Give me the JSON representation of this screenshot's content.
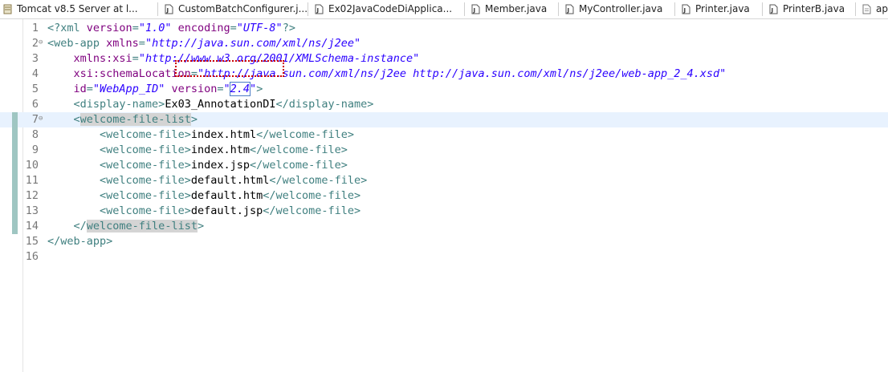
{
  "tabs": [
    {
      "label": "Tomcat v8.5 Server at l...",
      "icon": "server-icon"
    },
    {
      "label": "CustomBatchConfigurer.j...",
      "icon": "java-file-icon"
    },
    {
      "label": "Ex02JavaCodeDiApplica...",
      "icon": "java-file-icon"
    },
    {
      "label": "Member.java",
      "icon": "java-file-icon"
    },
    {
      "label": "MyController.java",
      "icon": "java-file-icon"
    },
    {
      "label": "Printer.java",
      "icon": "java-file-icon"
    },
    {
      "label": "PrinterB.java",
      "icon": "java-file-icon"
    },
    {
      "label": "ap",
      "icon": "file-icon"
    }
  ],
  "editor": {
    "lines": [
      {
        "n": "1",
        "fold": "",
        "t": [
          [
            "tag",
            "<?xml "
          ],
          [
            "attr",
            "version"
          ],
          [
            "tag",
            "="
          ],
          [
            "val",
            "\"1.0\""
          ],
          [
            "txt",
            " "
          ],
          [
            "attr",
            "encoding"
          ],
          [
            "tag",
            "="
          ],
          [
            "val",
            "\"UTF-8\""
          ],
          [
            "tag",
            "?>"
          ]
        ]
      },
      {
        "n": "2",
        "fold": "⊖",
        "t": [
          [
            "tag",
            "<web-app "
          ],
          [
            "attr",
            "xmlns"
          ],
          [
            "tag",
            "="
          ],
          [
            "val",
            "\"http://java.sun.com/xml/ns/j2ee\""
          ]
        ]
      },
      {
        "n": "3",
        "fold": "",
        "t": [
          [
            "txt",
            "    "
          ],
          [
            "attr",
            "xmlns:xsi"
          ],
          [
            "tag",
            "="
          ],
          [
            "val",
            "\"http://www.w3.org/2001/XMLSchema-instance\""
          ]
        ]
      },
      {
        "n": "4",
        "fold": "",
        "t": [
          [
            "txt",
            "    "
          ],
          [
            "attr",
            "xsi:schemaLocation"
          ],
          [
            "tag",
            "="
          ],
          [
            "val",
            "\"http://java.sun.com/xml/ns/j2ee http://java.sun.com/xml/ns/j2ee/web-app_2_4.xsd\""
          ]
        ]
      },
      {
        "n": "5",
        "fold": "",
        "t": [
          [
            "txt",
            "    "
          ],
          [
            "attr",
            "id"
          ],
          [
            "tag",
            "="
          ],
          [
            "val",
            "\"WebApp_ID\""
          ],
          [
            "txt",
            " "
          ],
          [
            "attr",
            "version"
          ],
          [
            "tag",
            "="
          ],
          [
            "val",
            "\""
          ],
          [
            "valc",
            "2.4"
          ],
          [
            "val",
            "\""
          ],
          [
            "tag",
            ">"
          ]
        ]
      },
      {
        "n": "6",
        "fold": "",
        "t": [
          [
            "txt",
            "    "
          ],
          [
            "tag",
            "<display-name>"
          ],
          [
            "txt",
            "Ex03_AnnotationDI"
          ],
          [
            "tag",
            "</display-name>"
          ]
        ]
      },
      {
        "n": "7",
        "fold": "⊖",
        "current": true,
        "t": [
          [
            "txt",
            "    "
          ],
          [
            "tag",
            "<"
          ],
          [
            "taghl",
            "welcome-file-list"
          ],
          [
            "tag",
            ">"
          ]
        ]
      },
      {
        "n": "8",
        "fold": "",
        "t": [
          [
            "txt",
            "        "
          ],
          [
            "tag",
            "<welcome-file>"
          ],
          [
            "txt",
            "index.html"
          ],
          [
            "tag",
            "</welcome-file>"
          ]
        ]
      },
      {
        "n": "9",
        "fold": "",
        "t": [
          [
            "txt",
            "        "
          ],
          [
            "tag",
            "<welcome-file>"
          ],
          [
            "txt",
            "index.htm"
          ],
          [
            "tag",
            "</welcome-file>"
          ]
        ]
      },
      {
        "n": "10",
        "fold": "",
        "t": [
          [
            "txt",
            "        "
          ],
          [
            "tag",
            "<welcome-file>"
          ],
          [
            "txt",
            "index.jsp"
          ],
          [
            "tag",
            "</welcome-file>"
          ]
        ]
      },
      {
        "n": "11",
        "fold": "",
        "t": [
          [
            "txt",
            "        "
          ],
          [
            "tag",
            "<welcome-file>"
          ],
          [
            "txt",
            "default.html"
          ],
          [
            "tag",
            "</welcome-file>"
          ]
        ]
      },
      {
        "n": "12",
        "fold": "",
        "t": [
          [
            "txt",
            "        "
          ],
          [
            "tag",
            "<welcome-file>"
          ],
          [
            "txt",
            "default.htm"
          ],
          [
            "tag",
            "</welcome-file>"
          ]
        ]
      },
      {
        "n": "13",
        "fold": "",
        "t": [
          [
            "txt",
            "        "
          ],
          [
            "tag",
            "<welcome-file>"
          ],
          [
            "txt",
            "default.jsp"
          ],
          [
            "tag",
            "</welcome-file>"
          ]
        ]
      },
      {
        "n": "14",
        "fold": "",
        "t": [
          [
            "txt",
            "    "
          ],
          [
            "tag",
            "</"
          ],
          [
            "taghl",
            "welcome-file-list"
          ],
          [
            "tag",
            ">"
          ]
        ]
      },
      {
        "n": "15",
        "fold": "",
        "t": [
          [
            "tag",
            "</web-app>"
          ]
        ]
      },
      {
        "n": "16",
        "fold": "",
        "t": []
      }
    ]
  },
  "colors": {
    "tag": "#3f7f7f",
    "attribute": "#7f007f",
    "value": "#2a00ff",
    "current_line": "#e8f2fe",
    "annotation_box": "#cc0000"
  }
}
